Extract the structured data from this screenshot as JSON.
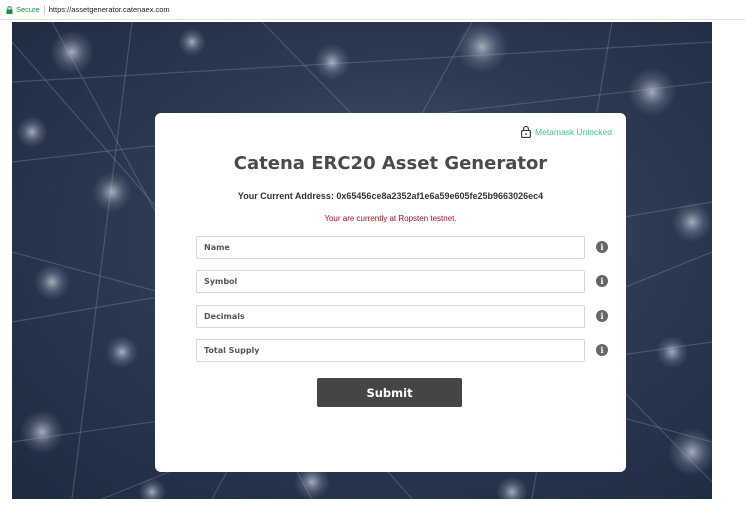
{
  "browser": {
    "secure_label": "Secure",
    "url": "https://assetgenerator.catenaex.com"
  },
  "card": {
    "lock_status": "Metamask Unlocked",
    "title": "Catena ERC20 Asset Generator",
    "address_line": "Your Current Address: 0x65456ce8a2352af1e6a59e605fe25b9663026ec4",
    "network_notice": "Your are currently at Ropsten testnet."
  },
  "form": {
    "fields": [
      {
        "placeholder": "Name",
        "value": ""
      },
      {
        "placeholder": "Symbol",
        "value": ""
      },
      {
        "placeholder": "Decimals",
        "value": ""
      },
      {
        "placeholder": "Total Supply",
        "value": ""
      }
    ],
    "info_glyph": "i",
    "submit_label": "Submit"
  },
  "colors": {
    "accent_green": "#3fc48f",
    "notice_red": "#a3141e",
    "button_bg": "#454545",
    "background": "#2c3a52"
  },
  "icons": {
    "secure": "padlock-icon",
    "status": "unlocked-padlock-icon",
    "field_help": "info-circle-icon"
  }
}
